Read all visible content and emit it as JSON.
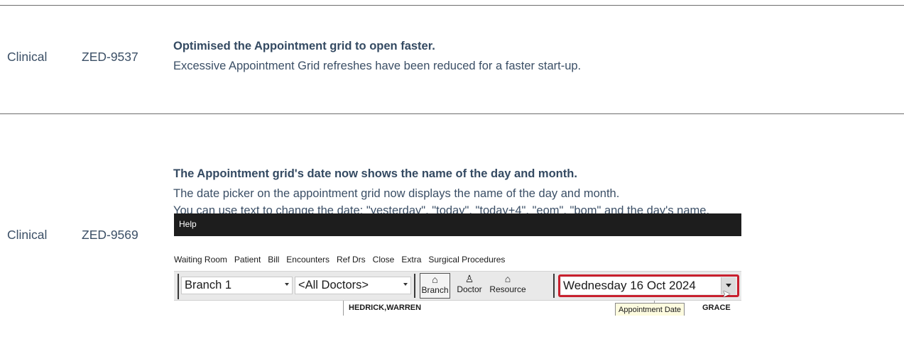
{
  "rows": [
    {
      "category": "Clinical",
      "id": "ZED-9537",
      "title": "Optimised the Appointment grid to open faster.",
      "lines": [
        "Excessive Appointment Grid refreshes have been reduced for a faster start-up."
      ]
    },
    {
      "category": "Clinical",
      "id": "ZED-9569",
      "title": "The Appointment grid's date now shows the name of the day and month.",
      "lines": [
        "The date picker on the appointment grid now displays the name of the day and month.",
        "You can use text to change the date: \"yesterday\", \"today\", \"today+4\", \"eom\", \"bom\" and the day's name."
      ]
    }
  ],
  "screenshot": {
    "titlebar_menu": "Help",
    "menu": [
      "Waiting Room",
      "Patient",
      "Bill",
      "Encounters",
      "Ref Drs",
      "Close",
      "Extra",
      "Surgical Procedures"
    ],
    "branch_combo": "Branch 1",
    "doctors_combo": "<All Doctors>",
    "buttons": [
      {
        "label": "Branch",
        "icon": "branch-house-icon"
      },
      {
        "label": "Doctor",
        "icon": "doctor-person-icon"
      },
      {
        "label": "Resource",
        "icon": "resource-building-icon"
      }
    ],
    "date_value": "Wednesday 16 Oct 2024",
    "grid_column_1": "HEDRICK,WARREN",
    "tooltip": "Appointment Date",
    "grid_column_2": "GRACE",
    "highlight_color": "#c8202e"
  },
  "colors": {
    "text": "#3b4f66",
    "border": "#2b2b2b"
  }
}
